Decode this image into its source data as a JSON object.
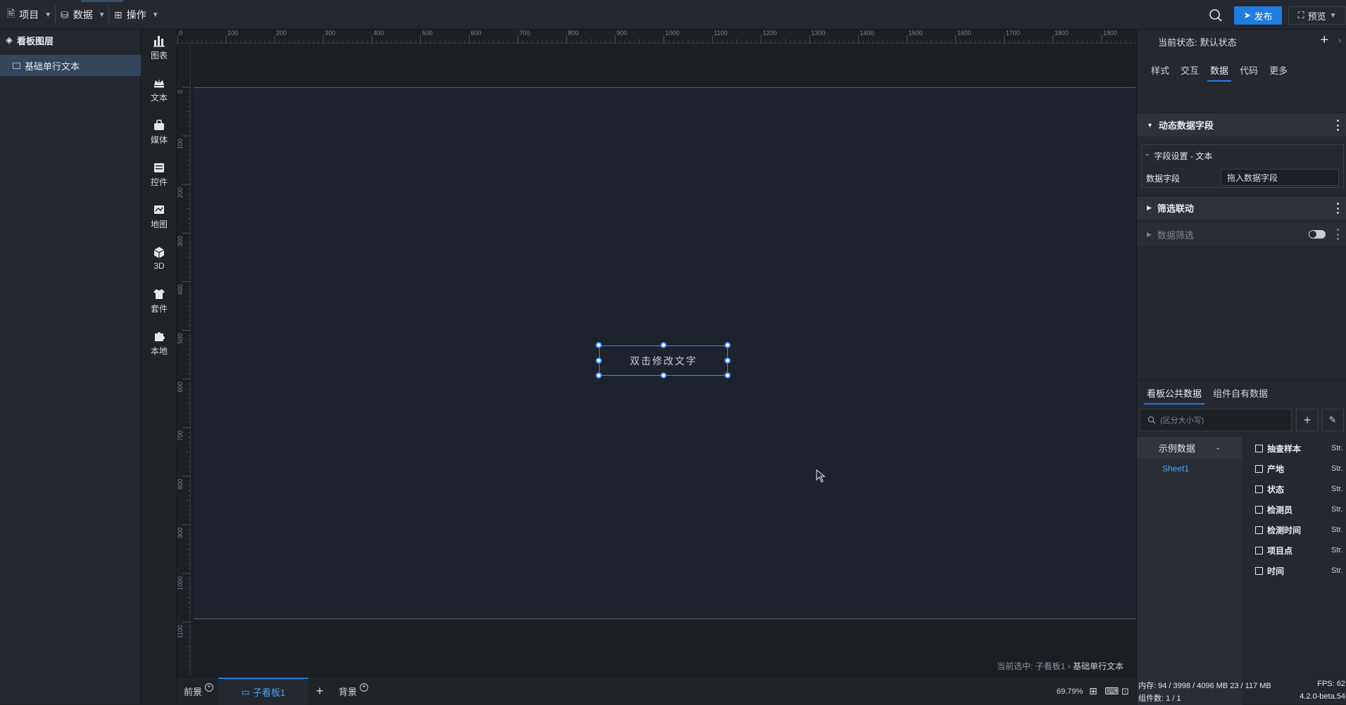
{
  "topbar": {
    "menus": [
      {
        "label": "项目",
        "icon": "file-icon"
      },
      {
        "label": "数据",
        "icon": "database-icon"
      },
      {
        "label": "操作",
        "icon": "grid-icon"
      }
    ],
    "publish_label": "发布",
    "preview_label": "预览",
    "accent_color": "#1f7ce0"
  },
  "layers": {
    "title": "看板图层",
    "items": [
      {
        "label": "基础单行文本"
      }
    ]
  },
  "components": [
    {
      "label": "图表",
      "icon": "bar-chart-icon"
    },
    {
      "label": "文本",
      "icon": "text-crown-icon"
    },
    {
      "label": "媒体",
      "icon": "media-icon"
    },
    {
      "label": "控件",
      "icon": "widget-icon"
    },
    {
      "label": "地图",
      "icon": "map-icon"
    },
    {
      "label": "3D",
      "icon": "cube-icon"
    },
    {
      "label": "套件",
      "icon": "shirt-icon"
    },
    {
      "label": "本地",
      "icon": "puzzle-icon"
    }
  ],
  "ruler": {
    "top_ticks": [
      "0",
      "100",
      "200",
      "300",
      "400",
      "500",
      "600",
      "700",
      "800",
      "900",
      "1000",
      "1100",
      "1200",
      "1300",
      "1400",
      "1500",
      "1600",
      "1700",
      "1800",
      "1900"
    ],
    "left_ticks": [
      "0",
      "100",
      "200",
      "300",
      "400",
      "500",
      "600",
      "700",
      "800",
      "900",
      "1000",
      "1100"
    ]
  },
  "canvas": {
    "text_component": "双击修改文字",
    "selection_prefix": "当前选中: 子看板1 ›",
    "selection_current": "基础单行文本"
  },
  "canvas_bottom": {
    "foreground": "前景",
    "sub_board": "子看板1",
    "add": "+",
    "background": "背景",
    "zoom": "69.79%"
  },
  "right_panel": {
    "state_label": "当前状态:",
    "state_value": "默认状态",
    "tabs": [
      "样式",
      "交互",
      "数据",
      "代码",
      "更多"
    ],
    "active_tab": "数据",
    "dynamic_fields": "动态数据字段",
    "field_settings": "字段设置 - 文本",
    "data_field_label": "数据字段",
    "data_field_placeholder": "拖入数据字段",
    "filter_link": "筛选联动",
    "data_filter": "数据筛选",
    "data_tabs": [
      "看板公共数据",
      "组件自有数据"
    ],
    "search_placeholder": "(区分大小写)",
    "source_select": "示例数据",
    "sheet": "Sheet1",
    "fields": [
      {
        "name": "抽查样本",
        "type": "Str."
      },
      {
        "name": "产地",
        "type": "Str."
      },
      {
        "name": "状态",
        "type": "Str."
      },
      {
        "name": "检测员",
        "type": "Str."
      },
      {
        "name": "检测时间",
        "type": "Str."
      },
      {
        "name": "项目点",
        "type": "Str."
      },
      {
        "name": "时间",
        "type": "Str."
      }
    ],
    "memory": "内存: 94 / 3998 / 4096 MB 23 / 117 MB",
    "fps": "FPS: 62",
    "components_count": "组件数: 1 / 1",
    "version": "4.2.0-beta.54"
  }
}
